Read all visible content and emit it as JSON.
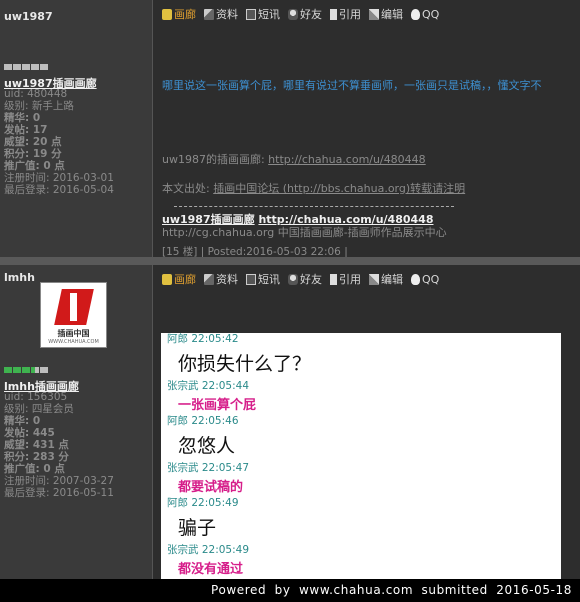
{
  "post1": {
    "author_name": "uw1987",
    "level_dots": 5,
    "name_link": "uw1987插画画廊",
    "stats": [
      "uid: 480448",
      "级别: 新手上路",
      "精华: 0",
      "发帖: 17",
      "威望: 20 点",
      "积分: 19 分",
      "推广值: 0 点",
      "注册时间: 2016-03-01",
      "最后登录: 2016-05-04"
    ],
    "toolbar": [
      "画廊",
      "资料",
      "短讯",
      "好友",
      "引用",
      "编辑",
      "QQ"
    ],
    "message": "哪里说这一张画算个屁，哪里有说过不算垂画师，一张画只是试稿，，懂文字不",
    "gallery_line_prefix": "uw1987的插画画廊: ",
    "gallery_url": "http://chahua.com/u/480448",
    "source_prefix": "本文出处: ",
    "source_text": "插画中国论坛 (http://bbs.chahua.org)转载请注明",
    "sig_name": "uw1987插画画廊",
    "sig_url": "http://chahua.com/u/480448",
    "sig_line2": "http://cg.chahua.org 中国插画画廊-插画师作品展示中心",
    "meta": "[15 楼] | Posted:2016-05-03 22:06 |"
  },
  "post2": {
    "author_name": "lmhh",
    "logo_text": "插画中国",
    "logo_sub": "WWW.CHAHUA.COM",
    "name_link": "lmhh插画画廊",
    "stats": [
      "uid: 156305",
      "级别: 四星会员",
      "精华: 0",
      "发帖: 445",
      "威望: 431 点",
      "积分: 283 分",
      "推广值: 0 点",
      "注册时间: 2007-03-27",
      "最后登录: 2016-05-11"
    ],
    "toolbar": [
      "画廊",
      "资料",
      "短讯",
      "好友",
      "引用",
      "编辑",
      "QQ"
    ],
    "chat": [
      {
        "who": "阿郎 22:05:42",
        "text": "你损失什么了？",
        "style": "a"
      },
      {
        "who": "张宗武 22:05:44",
        "text": "一张画算个屁",
        "style": "b"
      },
      {
        "who": "阿郎 22:05:46",
        "text": "忽悠人",
        "style": "a"
      },
      {
        "who": "张宗武 22:05:47",
        "text": "都要试稿的",
        "style": "b"
      },
      {
        "who": "阿郎 22:05:49",
        "text": "骗子",
        "style": "a"
      },
      {
        "who": "张宗武 22:05:49",
        "text": "都没有通过",
        "style": "b"
      }
    ]
  },
  "footer": {
    "text": "Powered by www.chahua.com submitted 2016-05-18"
  }
}
